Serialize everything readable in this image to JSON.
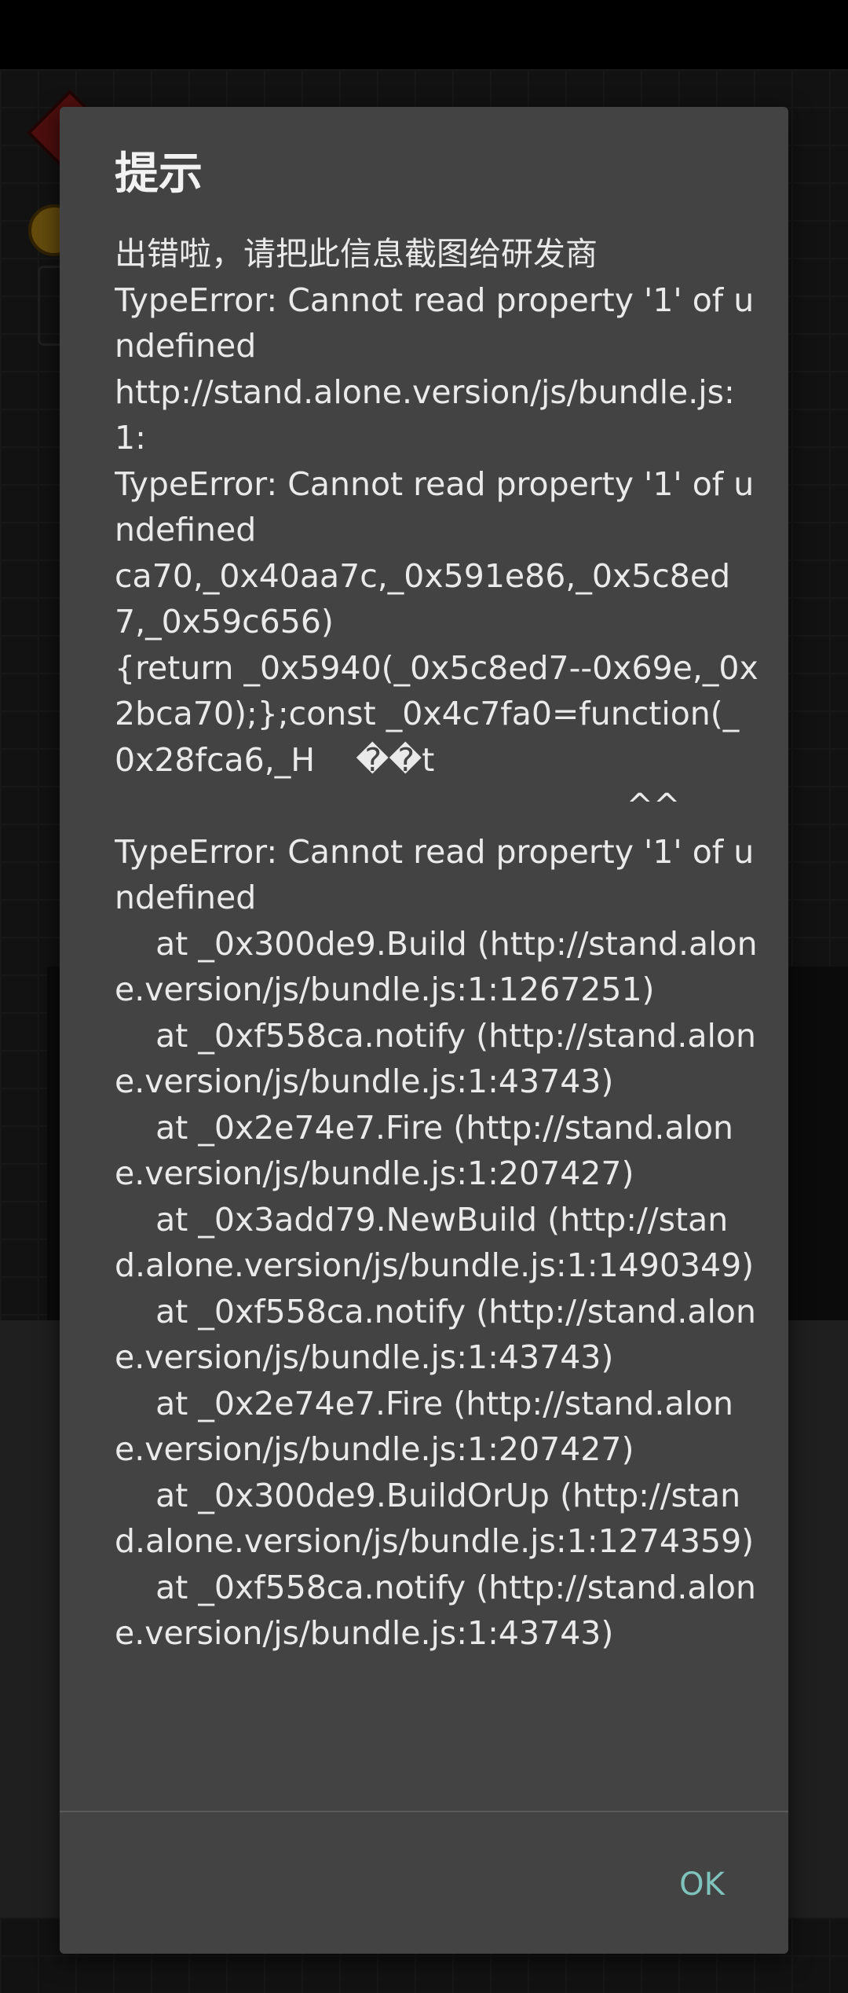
{
  "dialog": {
    "title": "提示",
    "message": "出错啦，请把此信息截图给研发商\nTypeError: Cannot read property '1' of undefined\nhttp://stand.alone.version/js/bundle.js:1:\nTypeError: Cannot read property '1' of undefined\nca70,_0x40aa7c,_0x591e86,_0x5c8ed7,_0x59c656)\n{return _0x5940(_0x5c8ed7--0x69e,_0x2bca70);};const _0x4c7fa0=function(_0x28fca6,_H    ��t\n                                                  ^^\nTypeError: Cannot read property '1' of undefined\n    at _0x300de9.Build (http://stand.alone.version/js/bundle.js:1:1267251)\n    at _0xf558ca.notify (http://stand.alone.version/js/bundle.js:1:43743)\n    at _0x2e74e7.Fire (http://stand.alone.version/js/bundle.js:1:207427)\n    at _0x3add79.NewBuild (http://stand.alone.version/js/bundle.js:1:1490349)\n    at _0xf558ca.notify (http://stand.alone.version/js/bundle.js:1:43743)\n    at _0x2e74e7.Fire (http://stand.alone.version/js/bundle.js:1:207427)\n    at _0x300de9.BuildOrUp (http://stand.alone.version/js/bundle.js:1:1274359)\n    at _0xf558ca.notify (http://stand.alone.version/js/bundle.js:1:43743)",
    "ok_label": "OK"
  },
  "colors": {
    "dialog_bg": "#434343",
    "accent_ok": "#7fc3bd",
    "text": "#eaeaea"
  }
}
